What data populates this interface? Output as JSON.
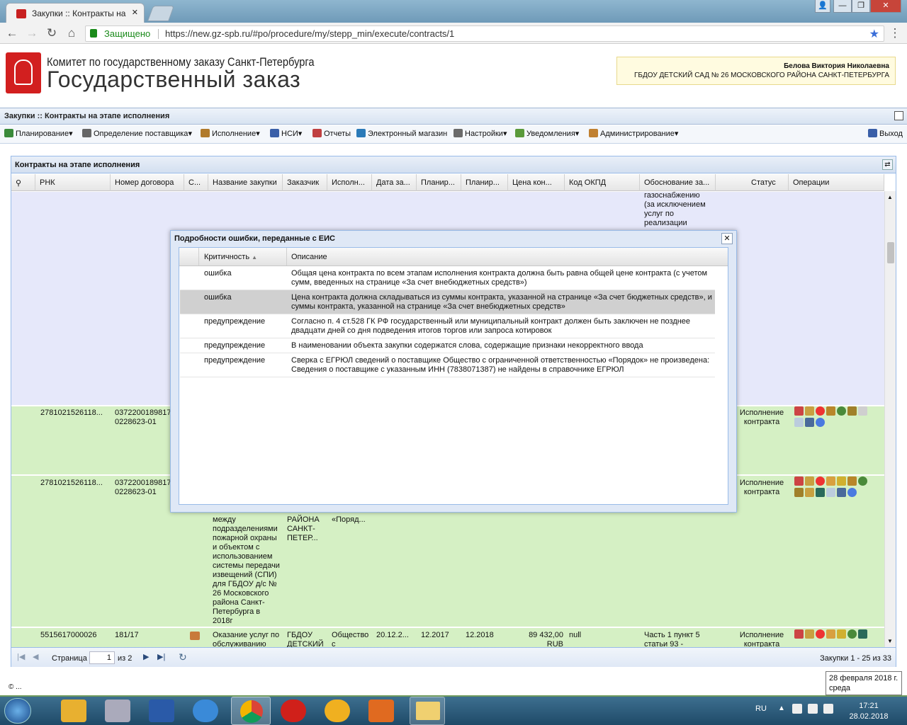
{
  "browser": {
    "tab_title": "Закупки :: Контракты на",
    "secure_label": "Защищено",
    "url": "https://new.gz-spb.ru/#po/procedure/my/stepp_min/execute/contracts/1",
    "win_buttons": [
      "Гость",
      "—",
      "❐",
      "✕"
    ]
  },
  "header": {
    "title_small": "Комитет по государственному заказу Санкт-Петербурга",
    "title_big": "Государственный заказ",
    "user_name": "Белова Виктория Николаевна",
    "user_org": "ГБДОУ ДЕТСКИЙ САД № 26 МОСКОВСКОГО РАЙОНА САНКТ-ПЕТЕРБУРГА"
  },
  "appbar": {
    "title": "Закупки :: Контракты на этапе исполнения"
  },
  "menu": {
    "items": [
      {
        "label": "Планирование",
        "icon": "planning-icon",
        "color": "#3a8a3a"
      },
      {
        "label": "Определение поставщика",
        "icon": "supplier-icon",
        "color": "#555555"
      },
      {
        "label": "Исполнение",
        "icon": "execution-icon",
        "color": "#b07a2a"
      },
      {
        "label": "НСИ",
        "icon": "book-icon",
        "color": "#3a5fa8"
      },
      {
        "label": "Отчеты",
        "icon": "report-icon",
        "color": "#c04040"
      },
      {
        "label": "Электронный магазин",
        "icon": "cart-icon",
        "color": "#2a7ab8"
      },
      {
        "label": "Настройки",
        "icon": "wrench-icon",
        "color": "#6a6a6a"
      },
      {
        "label": "Уведомления",
        "icon": "notify-icon",
        "color": "#5a9a3a"
      },
      {
        "label": "Администрирование",
        "icon": "admin-icon",
        "color": "#c08030"
      }
    ],
    "exit_label": "Выход"
  },
  "grid": {
    "title": "Контракты на этапе исполнения",
    "columns": [
      "РНК",
      "Номер договора",
      "С...",
      "Название закупки",
      "Заказчик",
      "Исполн...",
      "Дата за...",
      "Планир...",
      "Планир...",
      "Цена кон...",
      "Код ОКПД",
      "Обоснование за...",
      "Статус",
      "Операции"
    ],
    "top_row_basis": "газоснабжению\n(за исключением\nуслуг по\nреализации",
    "rows": [
      {
        "rnk": "2781021526118...",
        "contract": "03722001898170228623-01",
        "status": "Исполнение\nконтракта"
      },
      {
        "rnk": "2781021526118...",
        "contract": "03722001898170228623-01",
        "status": "Исполнение\nконтракта",
        "name_tail": "между\nподразделениями\nпожарной охраны\nи объектом с\nиспользованием\nсистемы передачи\nизвещений (СПИ)\nдля ГБДОУ д/с №\n26 Московского\nрайона Санкт-\nПетербурга в\n2018г",
        "customer_tail": "РАЙОНА\nСАНКТ-\nПЕТЕР...",
        "executor_tail": "«Поряд..."
      },
      {
        "rnk": "5515617000026",
        "contract": "181/17",
        "name": "Оказание услуг по\nобслуживанию",
        "customer": "ГБДОУ\nДЕТСКИЙ",
        "executor": "Общество\nс",
        "date": "20.12.2...",
        "plan1": "12.2017",
        "plan2": "12.2018",
        "price": "89 432,00\nRUB",
        "okpd": "null",
        "basis": "Часть 1 пункт 5\nстатьи 93 -",
        "status": "Исполнение\nконтракта"
      }
    ]
  },
  "pager": {
    "page_label": "Страница",
    "page_value": "1",
    "of_label": "из 2",
    "summary": "Закупки 1 - 25 из 33"
  },
  "dialog": {
    "title": "Подробности ошибки, переданные с ЕИС",
    "columns": [
      "Критичность",
      "Описание"
    ],
    "rows": [
      {
        "level": "ошибка",
        "text": "Общая цена контракта по всем этапам исполнения контракта должна быть равна общей цене контракта (с учетом\nсумм, введенных на странице «За счет внебюджетных средств»)"
      },
      {
        "level": "ошибка",
        "text": "Цена контракта должна складываться из суммы контракта, указанной на странице «За счет бюджетных средств», и\nсуммы контракта, указанной на странице «За счет внебюджетных средств»"
      },
      {
        "level": "предупреждение",
        "text": "Согласно п. 4 ст.528 ГК РФ государственный или муниципальный контракт должен быть заключен не позднее\nдвадцати дней со дня подведения итогов торгов или запроса котировок"
      },
      {
        "level": "предупреждение",
        "text": "В наименовании объекта закупки содержатся слова, содержащие признаки некорректного ввода"
      },
      {
        "level": "предупреждение",
        "text": "Сверка с ЕГРЮЛ сведений о поставщике Общество с ограниченной ответственностью «Порядок» не произведена:\nСведения о поставщике с указанным ИНН (7838071387) не найдены в справочнике ЕГРЮЛ"
      }
    ]
  },
  "footer": {
    "copyright": "© ..."
  },
  "taskbar": {
    "lang": "RU",
    "time": "17:21",
    "date": "28.02.2018",
    "tooltip": "28 февраля 2018 г.\nсреда"
  },
  "colors": {
    "row_green": "#d5f0c4",
    "row_lilac": "#e6e8fa",
    "accent": "#1a7f1a"
  }
}
